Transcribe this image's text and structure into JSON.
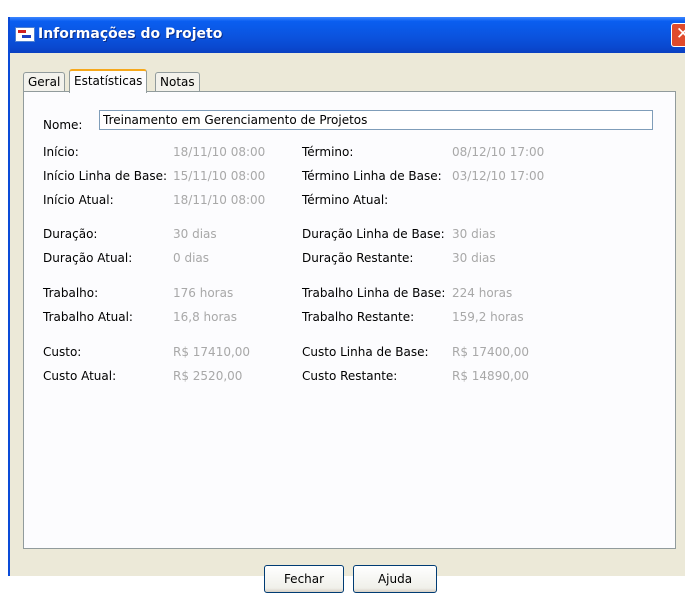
{
  "window": {
    "title": "Informações do Projeto",
    "close_label": "✕"
  },
  "tabs": [
    {
      "label": "Geral"
    },
    {
      "label": "Estatísticas"
    },
    {
      "label": "Notas"
    }
  ],
  "nome": {
    "label": "Nome:",
    "value": "Treinamento em Gerenciamento de Projetos"
  },
  "stats": {
    "inicio": {
      "label": "Início:",
      "value": "18/11/10 08:00"
    },
    "termino": {
      "label": "Término:",
      "value": "08/12/10 17:00"
    },
    "inicio_base": {
      "label": "Início Linha de Base:",
      "value": "15/11/10 08:00"
    },
    "termino_base": {
      "label": "Término Linha de Base:",
      "value": "03/12/10 17:00"
    },
    "inicio_atual": {
      "label": "Início Atual:",
      "value": "18/11/10 08:00"
    },
    "termino_atual": {
      "label": "Término Atual:",
      "value": ""
    },
    "duracao": {
      "label": "Duração:",
      "value": "30 dias"
    },
    "duracao_base": {
      "label": "Duração Linha de Base:",
      "value": "30 dias"
    },
    "duracao_atual": {
      "label": "Duração Atual:",
      "value": "0 dias"
    },
    "duracao_restante": {
      "label": "Duração Restante:",
      "value": "30 dias"
    },
    "trabalho": {
      "label": "Trabalho:",
      "value": "176 horas"
    },
    "trabalho_base": {
      "label": "Trabalho Linha de Base:",
      "value": "224 horas"
    },
    "trabalho_atual": {
      "label": "Trabalho Atual:",
      "value": "16,8 horas"
    },
    "trabalho_restante": {
      "label": "Trabalho Restante:",
      "value": "159,2 horas"
    },
    "custo": {
      "label": "Custo:",
      "value": "R$ 17410,00"
    },
    "custo_base": {
      "label": "Custo Linha de Base:",
      "value": "R$ 17400,00"
    },
    "custo_atual": {
      "label": "Custo Atual:",
      "value": "R$ 2520,00"
    },
    "custo_restante": {
      "label": "Custo Restante:",
      "value": "R$ 14890,00"
    }
  },
  "buttons": {
    "fechar": "Fechar",
    "ajuda": "Ajuda"
  }
}
